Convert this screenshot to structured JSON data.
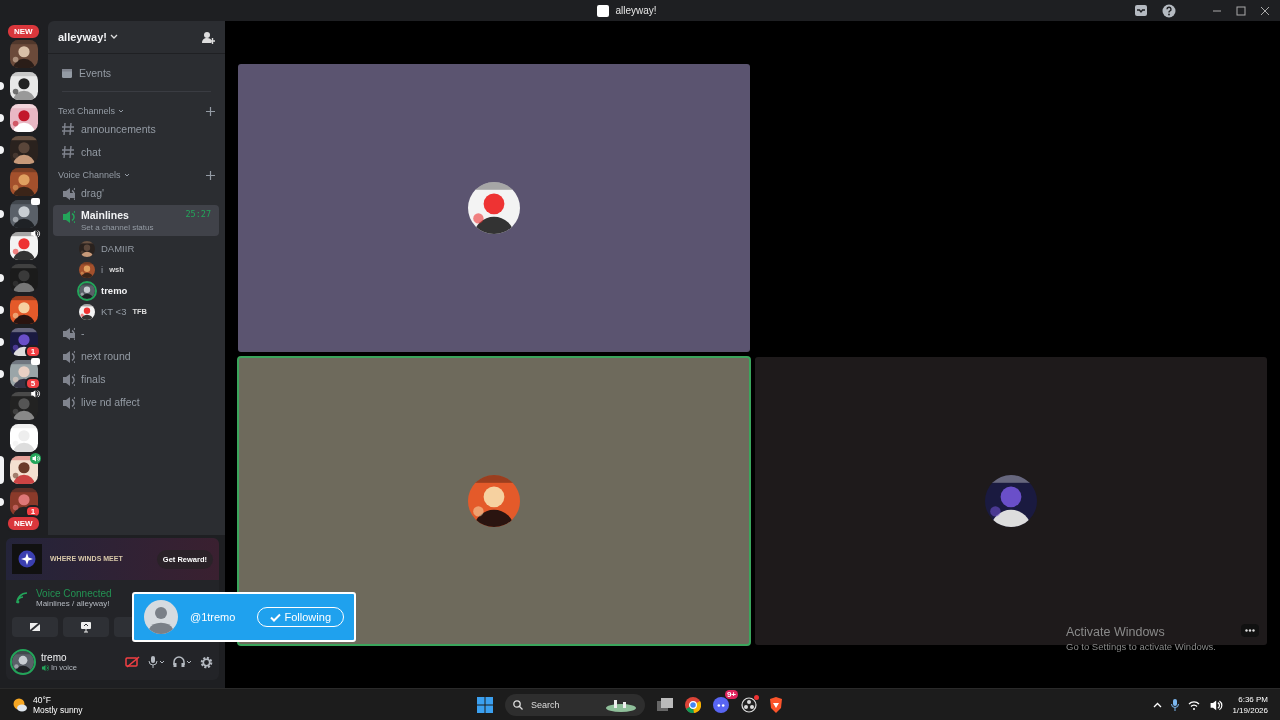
{
  "window": {
    "title": "alleyway!"
  },
  "rail": {
    "top_pill": "NEW",
    "bottom_pill": "NEW",
    "servers": [
      {
        "kind": "plain",
        "unread": false,
        "selected": false
      },
      {
        "kind": "plain",
        "unread": true,
        "selected": false
      },
      {
        "kind": "plain",
        "unread": true,
        "selected": false
      },
      {
        "kind": "plain",
        "unread": true,
        "selected": false
      },
      {
        "kind": "plain",
        "unread": false,
        "selected": false
      },
      {
        "kind": "chat",
        "unread": true,
        "selected": false
      },
      {
        "kind": "voice",
        "unread": false,
        "selected": false
      },
      {
        "kind": "plain",
        "unread": true,
        "selected": false
      },
      {
        "kind": "plain",
        "unread": true,
        "selected": false
      },
      {
        "kind": "plain",
        "unread": true,
        "selected": false,
        "badge": "1"
      },
      {
        "kind": "chat",
        "unread": true,
        "selected": false,
        "badge": "5"
      },
      {
        "kind": "voice",
        "unread": false,
        "selected": false
      },
      {
        "kind": "plain",
        "unread": false,
        "selected": false
      },
      {
        "kind": "live",
        "unread": false,
        "selected": true
      },
      {
        "kind": "plain",
        "unread": true,
        "selected": false,
        "badge": "1"
      }
    ]
  },
  "sidebar": {
    "server_name": "alleyway!",
    "events": "Events",
    "categories": [
      {
        "name": "Text Channels",
        "channels": [
          {
            "kind": "text",
            "name": "announcements",
            "selected": false
          },
          {
            "kind": "text",
            "name": "chat",
            "selected": false
          }
        ]
      },
      {
        "name": "Voice Channels",
        "channels": [
          {
            "kind": "locked",
            "name": "drag'",
            "selected": false
          },
          {
            "kind": "voice",
            "name": "Mainlines",
            "selected": true,
            "timer": "25:27",
            "status": "Set a channel status",
            "members": [
              {
                "name": "DAMIIR",
                "speaking": false
              },
              {
                "name": "i",
                "tag": "wsh",
                "speaking": false
              },
              {
                "name": "tremo",
                "speaking": true
              },
              {
                "name": "KT <3",
                "tag": "TFB",
                "speaking": false
              }
            ]
          },
          {
            "kind": "locked",
            "name": "-",
            "selected": false
          },
          {
            "kind": "voice",
            "name": "next round",
            "selected": false
          },
          {
            "kind": "voice",
            "name": "finals",
            "selected": false
          },
          {
            "kind": "voice",
            "name": "live nd affect",
            "selected": false
          }
        ]
      }
    ]
  },
  "promo": {
    "logo_text": "WHERE WINDS MEET",
    "button": "Get Reward!"
  },
  "voice": {
    "title": "Voice Connected",
    "location": "Mainlines / alleyway!"
  },
  "user": {
    "name": "tremo",
    "status": "In voice",
    "camera_off": true
  },
  "popup": {
    "handle": "@1tremo",
    "button": "Following"
  },
  "tiles": [
    {
      "kind": "video",
      "speaking": false,
      "color": "#5b5470"
    },
    {
      "kind": "empty"
    },
    {
      "kind": "video",
      "speaking": true,
      "color": "#6e6a5c"
    },
    {
      "kind": "video",
      "speaking": false,
      "color": "#1e1a1b",
      "more": true
    }
  ],
  "watermark": {
    "title": "Activate Windows",
    "subtitle": "Go to Settings to activate Windows."
  },
  "taskbar": {
    "weather_temp": "40°F",
    "weather_text": "Mostly sunny",
    "search": "Search",
    "discord_badge": "9+",
    "time": "6:36 PM",
    "date": "1/19/2026"
  }
}
